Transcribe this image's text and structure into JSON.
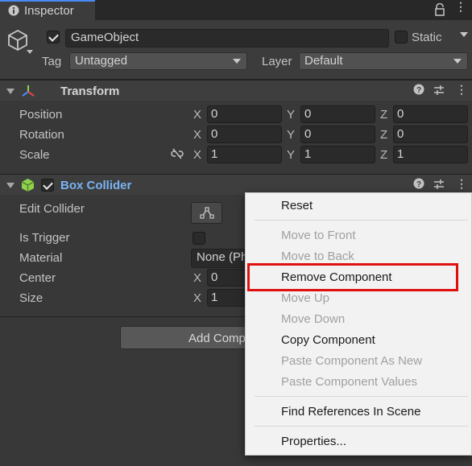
{
  "tab": {
    "label": "Inspector",
    "icon": "info-icon"
  },
  "header": {
    "active_checked": true,
    "name": "GameObject",
    "static_label": "Static",
    "static_checked": false,
    "tag_label": "Tag",
    "tag_value": "Untagged",
    "layer_label": "Layer",
    "layer_value": "Default"
  },
  "transform": {
    "title": "Transform",
    "rows": [
      {
        "label": "Position",
        "x": "0",
        "y": "0",
        "z": "0"
      },
      {
        "label": "Rotation",
        "x": "0",
        "y": "0",
        "z": "0"
      },
      {
        "label": "Scale",
        "x": "1",
        "y": "1",
        "z": "1"
      }
    ],
    "axis_labels": [
      "X",
      "Y",
      "Z"
    ]
  },
  "box_collider": {
    "title": "Box Collider",
    "enabled": true,
    "edit_collider_label": "Edit Collider",
    "is_trigger_label": "Is Trigger",
    "material_label": "Material",
    "material_value": "None (Ph",
    "center_label": "Center",
    "center_x": "0",
    "size_label": "Size",
    "size_x": "1"
  },
  "add_component_label": "Add Comp",
  "context_menu": {
    "items": [
      {
        "label": "Reset",
        "enabled": true
      },
      {
        "label": "Move to Front",
        "enabled": false
      },
      {
        "label": "Move to Back",
        "enabled": false
      },
      {
        "label": "Remove Component",
        "enabled": true,
        "highlighted": true
      },
      {
        "label": "Move Up",
        "enabled": false
      },
      {
        "label": "Move Down",
        "enabled": false
      },
      {
        "label": "Copy Component",
        "enabled": true
      },
      {
        "label": "Paste Component As New",
        "enabled": false
      },
      {
        "label": "Paste Component Values",
        "enabled": false
      },
      {
        "label": "Find References In Scene",
        "enabled": true
      },
      {
        "label": "Properties...",
        "enabled": true
      }
    ]
  },
  "colors": {
    "background": "#383838",
    "accent_blue": "#7ab3f4",
    "highlight_red": "#e01010",
    "menu_bg": "#f2f2f2"
  }
}
